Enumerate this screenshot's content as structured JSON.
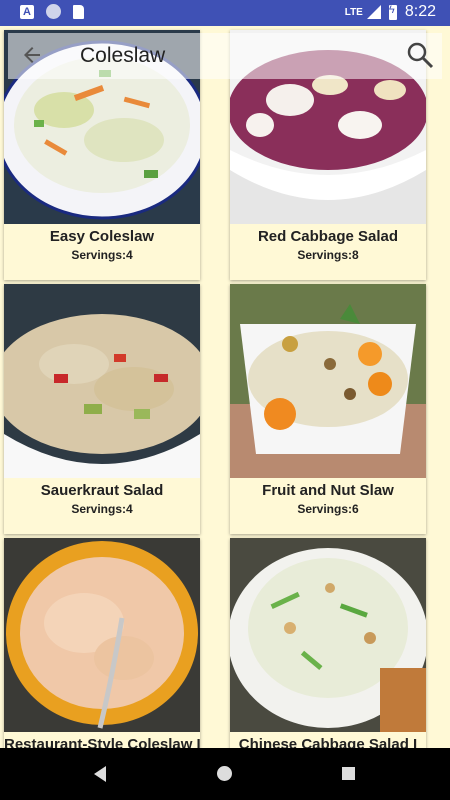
{
  "status_bar": {
    "network": "LTE",
    "time": "8:22"
  },
  "toolbar": {
    "title": "Coleslaw"
  },
  "recipes": [
    {
      "title": "Easy Coleslaw",
      "servings": "Servings:4"
    },
    {
      "title": "Red Cabbage Salad",
      "servings": "Servings:8"
    },
    {
      "title": "Sauerkraut Salad",
      "servings": "Servings:4"
    },
    {
      "title": "Fruit and Nut Slaw",
      "servings": "Servings:6"
    },
    {
      "title": "Restaurant-Style Coleslaw I",
      "servings": ""
    },
    {
      "title": "Chinese Cabbage Salad I",
      "servings": ""
    }
  ],
  "colors": {
    "status_bar": "#3F51B5",
    "card_bg": "#FFF9D6",
    "nav_bar": "#000000"
  }
}
